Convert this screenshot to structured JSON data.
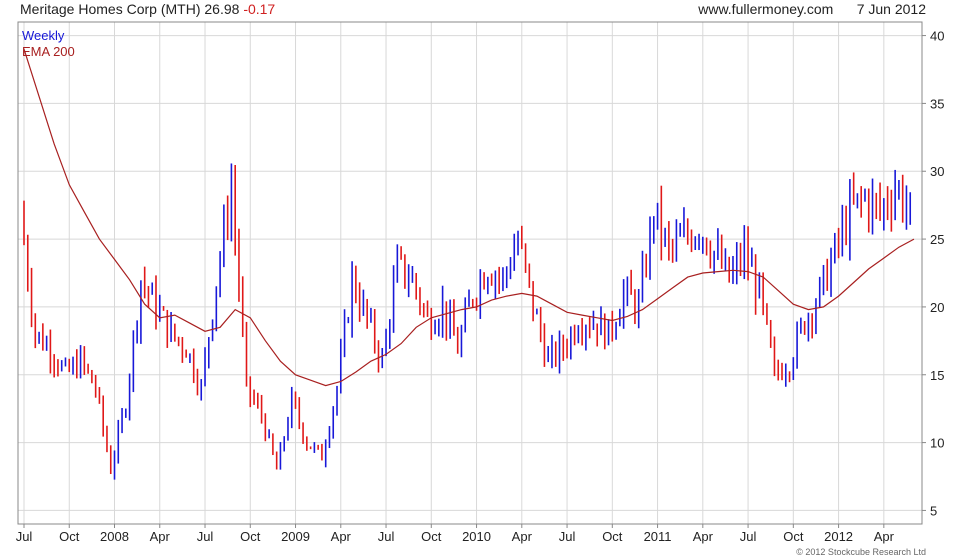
{
  "header": {
    "company": "Meritage Homes Corp (MTH)",
    "price": "26.98",
    "change": "-0.17",
    "site": "www.fullermoney.com",
    "date": "7 Jun 2012"
  },
  "footer": {
    "copyright": "© 2012 Stockcube Research Ltd"
  },
  "colors": {
    "up": "#1818d8",
    "down": "#e01818",
    "ema": "#a82020",
    "grid": "#d8d8d8",
    "frame": "#888888"
  },
  "chart_data": {
    "type": "line",
    "series": [
      {
        "name": "Weekly",
        "kind": "weekly-candles",
        "x": [
          "2007-07",
          "2007-08",
          "2007-09",
          "2007-10",
          "2007-11",
          "2007-12",
          "2008-01",
          "2008-02",
          "2008-03",
          "2008-04",
          "2008-05",
          "2008-06",
          "2008-07",
          "2008-08",
          "2008-09",
          "2008-10",
          "2008-11",
          "2008-12",
          "2009-01",
          "2009-02",
          "2009-03",
          "2009-04",
          "2009-05",
          "2009-06",
          "2009-07",
          "2009-08",
          "2009-09",
          "2009-10",
          "2009-11",
          "2009-12",
          "2010-01",
          "2010-02",
          "2010-03",
          "2010-04",
          "2010-05",
          "2010-06",
          "2010-07",
          "2010-08",
          "2010-09",
          "2010-10",
          "2010-11",
          "2010-12",
          "2011-01",
          "2011-02",
          "2011-03",
          "2011-04",
          "2011-05",
          "2011-06",
          "2011-07",
          "2011-08",
          "2011-09",
          "2011-10",
          "2011-11",
          "2011-12",
          "2012-01",
          "2012-02",
          "2012-03",
          "2012-04",
          "2012-05",
          "2012-06"
        ],
        "close": [
          27,
          18,
          17,
          15,
          16,
          14,
          8,
          13,
          22,
          20,
          18,
          17,
          14,
          22,
          29,
          14,
          12,
          8,
          13,
          10,
          9,
          14,
          22,
          19,
          16,
          23,
          22,
          19,
          20,
          17,
          21,
          23,
          22,
          25,
          20,
          16,
          17,
          19,
          19,
          18,
          21,
          20,
          27,
          24,
          25,
          26,
          24,
          22,
          24,
          21,
          15,
          16,
          19,
          21,
          24,
          27,
          28,
          27,
          29,
          27
        ]
      },
      {
        "name": "EMA 200",
        "x": [
          "2007-07",
          "2007-08",
          "2007-09",
          "2007-10",
          "2007-11",
          "2007-12",
          "2008-01",
          "2008-02",
          "2008-03",
          "2008-04",
          "2008-05",
          "2008-06",
          "2008-07",
          "2008-08",
          "2008-09",
          "2008-10",
          "2008-11",
          "2008-12",
          "2009-01",
          "2009-02",
          "2009-03",
          "2009-04",
          "2009-05",
          "2009-06",
          "2009-07",
          "2009-08",
          "2009-09",
          "2009-10",
          "2009-11",
          "2009-12",
          "2010-01",
          "2010-02",
          "2010-03",
          "2010-04",
          "2010-05",
          "2010-06",
          "2010-07",
          "2010-08",
          "2010-09",
          "2010-10",
          "2010-11",
          "2010-12",
          "2011-01",
          "2011-02",
          "2011-03",
          "2011-04",
          "2011-05",
          "2011-06",
          "2011-07",
          "2011-08",
          "2011-09",
          "2011-10",
          "2011-11",
          "2011-12",
          "2012-01",
          "2012-02",
          "2012-03",
          "2012-04",
          "2012-05",
          "2012-06"
        ],
        "values": [
          39,
          35.5,
          32,
          29,
          27,
          25,
          23.5,
          22,
          20.2,
          19.2,
          19.4,
          18.8,
          18.2,
          18.5,
          19.8,
          19.2,
          17.5,
          16,
          15,
          14.6,
          14.2,
          14.5,
          15.2,
          16,
          16.5,
          17.3,
          18.5,
          19.2,
          19.5,
          19.8,
          20,
          20.5,
          20.8,
          21,
          20.8,
          20.2,
          19.6,
          19.4,
          19.2,
          19,
          19.3,
          19.8,
          20.6,
          21.4,
          22.2,
          22.5,
          22.6,
          22.7,
          22.6,
          22.2,
          21.2,
          20.2,
          19.8,
          20,
          20.8,
          21.8,
          22.8,
          23.6,
          24.4,
          25
        ]
      }
    ],
    "x_ticks": [
      "Jul",
      "Oct",
      "2008",
      "Apr",
      "Jul",
      "Oct",
      "2009",
      "Apr",
      "Jul",
      "Oct",
      "2010",
      "Apr",
      "Jul",
      "Oct",
      "2011",
      "Apr",
      "Jul",
      "Oct",
      "2012",
      "Apr"
    ],
    "y_ticks": [
      5,
      10,
      15,
      20,
      25,
      30,
      35,
      40
    ],
    "ylim": [
      4,
      41
    ],
    "grid": true,
    "legend": "top-left",
    "y_axis_side": "right"
  }
}
